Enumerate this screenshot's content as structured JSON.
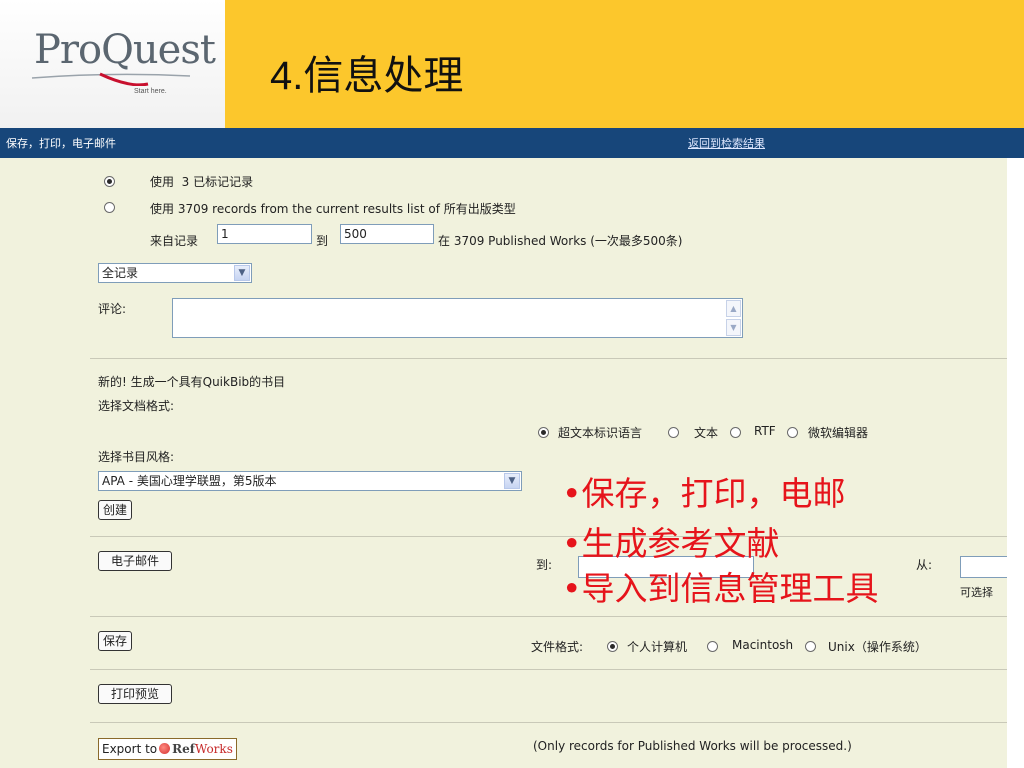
{
  "slide": {
    "logo": "ProQuest",
    "logo_tagline": "Start here.",
    "title": "4.信息处理"
  },
  "header": {
    "strip_title": "保存，打印，电子邮件",
    "back_link": "返回到检索结果"
  },
  "records": {
    "option_marked": {
      "prefix": "使用",
      "count": "3",
      "suffix": "已标记记录",
      "selected": true
    },
    "option_results": {
      "text": "使用  3709 records from the current results list of 所有出版类型",
      "selected": false
    },
    "range_label": "来自记录",
    "range_from": "1",
    "range_to_label": "到",
    "range_to": "500",
    "range_note": "在  3709 Published Works (一次最多500条)"
  },
  "content_select": {
    "value": "全记录"
  },
  "comment": {
    "label": "评论:",
    "value": ""
  },
  "bibliography": {
    "intro": "新的! 生成一个具有QuikBib的书目",
    "format_label": "选择文档格式:",
    "formats": [
      {
        "label": "超文本标识语言",
        "selected": true
      },
      {
        "label": "文本",
        "selected": false
      },
      {
        "label": "RTF",
        "selected": false
      },
      {
        "label": "微软编辑器",
        "selected": false
      }
    ],
    "style_label": "选择书目风格:",
    "style_value": "APA - 美国心理学联盟，第5版本",
    "create_button": "创建"
  },
  "email": {
    "button": "电子邮件",
    "to_label": "到:",
    "from_label": "从:",
    "optional_note": "可选择"
  },
  "save": {
    "button": "保存",
    "format_label": "文件格式:",
    "formats": [
      {
        "label": "个人计算机",
        "selected": true
      },
      {
        "label": "Macintosh",
        "selected": false
      },
      {
        "label": "Unix（操作系统）",
        "selected": false
      }
    ]
  },
  "print": {
    "button": "打印预览"
  },
  "export": {
    "button_prefix": "Export to",
    "brand_ref": "Ref",
    "brand_works": "Works",
    "note": "(Only records for Published Works will be processed.)"
  },
  "overlay_bullets": [
    "•保存，打印，电邮",
    "•生成参考文献",
    "•导入到信息管理工具"
  ],
  "colors": {
    "title_bar": "#fcc72c",
    "app_strip": "#17467a",
    "content_bg": "#f1f2dd",
    "bullet_red": "#e6141b"
  }
}
